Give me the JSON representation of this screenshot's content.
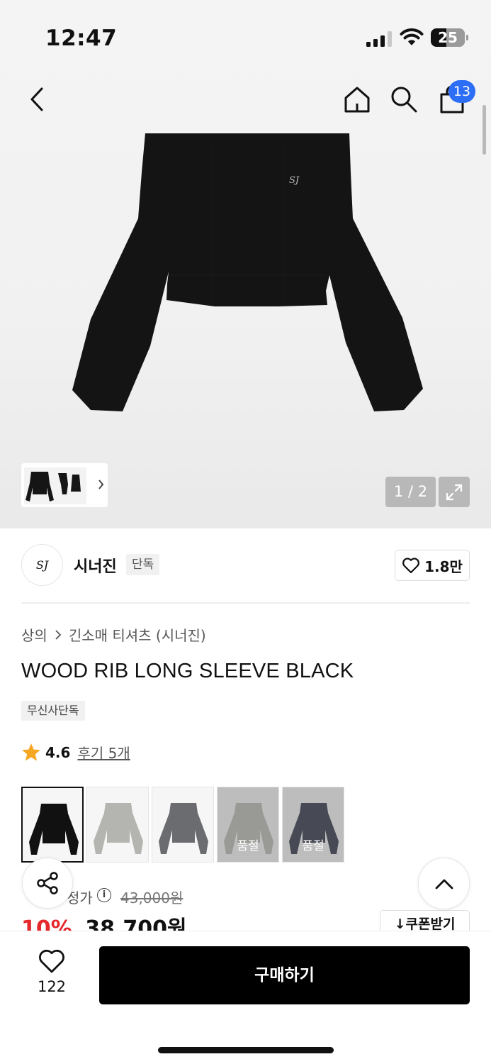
{
  "status_bar": {
    "time": "12:47",
    "battery": "25"
  },
  "header": {
    "cart_count": "13"
  },
  "gallery": {
    "counter": "1 / 2"
  },
  "brand": {
    "logo_text": "SJ",
    "name": "시너진",
    "tag": "단독",
    "likes": "1.8만"
  },
  "breadcrumb": {
    "category": "상의",
    "subcategory": "긴소매 티셔츠 (시너진)"
  },
  "product": {
    "title": "WOOD RIB LONG SLEEVE BLACK",
    "exclusive_tag": "무신사단독",
    "rating": "4.6",
    "reviews": "후기 5개"
  },
  "colors": [
    {
      "color": "#111111",
      "soldout": false,
      "selected": true,
      "label": ""
    },
    {
      "color": "#b4b4b0",
      "soldout": false,
      "selected": false,
      "label": ""
    },
    {
      "color": "#6b6c70",
      "soldout": false,
      "selected": false,
      "label": ""
    },
    {
      "color": "#b4b4b0",
      "soldout": true,
      "selected": false,
      "label": "품절"
    },
    {
      "color": "#1f2637",
      "soldout": true,
      "selected": false,
      "label": "품절"
    }
  ],
  "price": {
    "label": "정가",
    "original": "43,000원",
    "discount": "10%",
    "sale": "38,700원",
    "coupon_label": "쿠폰받기"
  },
  "bottom": {
    "wish_count": "122",
    "buy_label": "구매하기"
  },
  "theme": {
    "accent_blue": "#2d6ef6",
    "sale_red": "#e5282b"
  }
}
